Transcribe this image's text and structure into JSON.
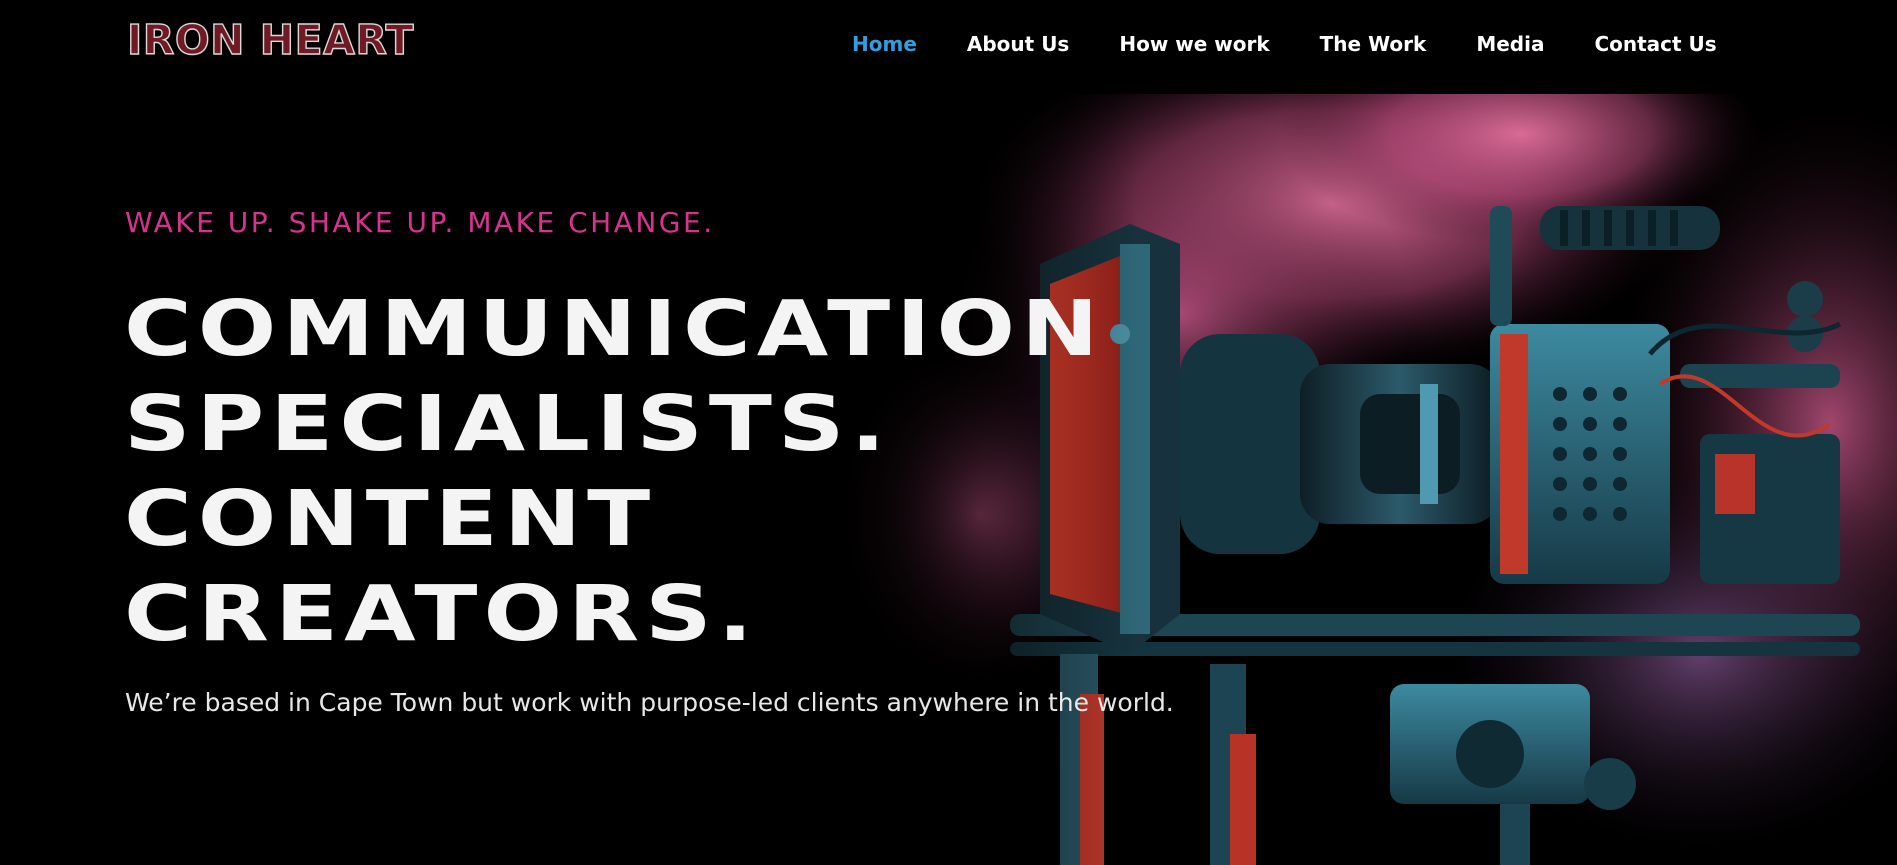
{
  "header": {
    "logo_text": "IRON HEART",
    "nav": [
      {
        "label": "Home",
        "active": true
      },
      {
        "label": "About Us",
        "active": false
      },
      {
        "label": "How we work",
        "active": false
      },
      {
        "label": "The Work",
        "active": false
      },
      {
        "label": "Media",
        "active": false
      },
      {
        "label": "Contact Us",
        "active": false
      }
    ]
  },
  "hero": {
    "tagline": "WAKE UP. SHAKE UP. MAKE CHANGE.",
    "headline": [
      "COMMUNICATION",
      "SPECIALISTS.",
      "CONTENT",
      "CREATORS."
    ],
    "subtext": "We’re based in Cape Town but work with purpose-led clients anywhere in the world."
  },
  "colors": {
    "accent_pink": "#d6338f",
    "nav_active": "#2f9fe0",
    "background": "#000000",
    "headline": "#f4f4f4"
  },
  "icons": {
    "hero_image": "cinema-camera-rig-in-pink-smoke"
  }
}
